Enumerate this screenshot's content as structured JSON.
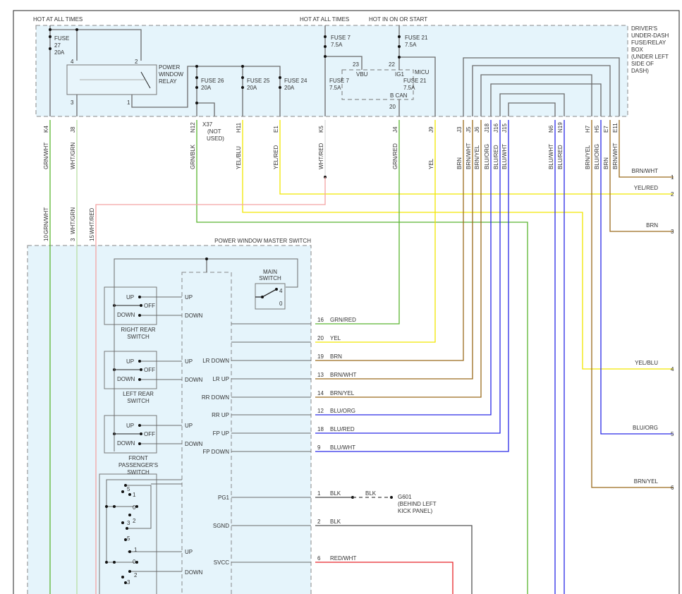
{
  "header": {
    "hot_all_times_1": "HOT AT ALL TIMES",
    "hot_all_times_2": "HOT AT ALL TIMES",
    "hot_on_start": "HOT IN ON OR START"
  },
  "fuse_box": {
    "label_lines": [
      "DRIVER'S",
      "UNDER-DASH",
      "FUSE/RELAY",
      "BOX",
      "(UNDER LEFT",
      "SIDE OF",
      "DASH)"
    ]
  },
  "fuses": [
    {
      "name": "FUSE",
      "num": "27",
      "amp": "20A"
    },
    {
      "name": "FUSE 26",
      "amp": "20A"
    },
    {
      "name": "FUSE 25",
      "amp": "20A"
    },
    {
      "name": "FUSE 24",
      "amp": "20A"
    },
    {
      "name": "FUSE 7",
      "amp": "7.5A"
    },
    {
      "name": "FUSE 21",
      "amp": "7.5A"
    }
  ],
  "relay": {
    "lines": [
      "POWER",
      "WINDOW",
      "RELAY"
    ],
    "pins": [
      "4",
      "2",
      "3",
      "1"
    ]
  },
  "micu": {
    "label": "MICU",
    "vbu": "VBU",
    "ig1": "IG1",
    "bcan": "B CAN",
    "pin23": "23",
    "pin22": "22",
    "pin20": "20"
  },
  "x37": {
    "pin": "X37",
    "note1": "(NOT",
    "note2": "USED)"
  },
  "colors": {
    "GRN": "#5bb531",
    "LTGRN": "#b9dea4",
    "YEL": "#f2e600",
    "RED": "#e8262a",
    "PINK": "#f3a3a3",
    "BRN": "#9a6b1c",
    "BLU": "#2a2ae6",
    "GRY": "#6b6b6b",
    "fill": "#e5f4fb"
  },
  "connectors": [
    {
      "pin": "K4",
      "wire": "GRN/WHT"
    },
    {
      "pin": "J8",
      "wire": "WHT/GRN"
    },
    {
      "pin": "N12",
      "wire": "GRN/BLK"
    },
    {
      "pin": "H11",
      "wire": "YEL/BLU"
    },
    {
      "pin": "E1",
      "wire": "YEL/RED"
    },
    {
      "pin": "K5",
      "wire": "WHT/RED"
    },
    {
      "pin": "J4",
      "wire": "GRN/RED"
    },
    {
      "pin": "J9",
      "wire": "YEL"
    },
    {
      "pin": "J3",
      "wire": "BRN"
    },
    {
      "pin": "J5",
      "wire": "BRN/WHT"
    },
    {
      "pin": "J6",
      "wire": "BRN/YEL"
    },
    {
      "pin": "J18",
      "wire": "BLU/ORG"
    },
    {
      "pin": "J16",
      "wire": "BLU/RED"
    },
    {
      "pin": "J15",
      "wire": "BLU/WHT"
    },
    {
      "pin": "N6",
      "wire": "BLU/WHT"
    },
    {
      "pin": "N19",
      "wire": "BLU/RED"
    },
    {
      "pin": "H7",
      "wire": "BRN/YEL"
    },
    {
      "pin": "H5",
      "wire": "BLU/ORG"
    },
    {
      "pin": "E7",
      "wire": "BRN"
    },
    {
      "pin": "E11",
      "wire": "BRN/WHT"
    }
  ],
  "outputs": [
    {
      "num": "1",
      "wire": "BRN/WHT"
    },
    {
      "num": "2",
      "wire": "YEL/RED"
    },
    {
      "num": "3",
      "wire": "BRN"
    },
    {
      "num": "4",
      "wire": "YEL/BLU"
    },
    {
      "num": "5",
      "wire": "BLU/ORG"
    },
    {
      "num": "6",
      "wire": "BRN/YEL"
    }
  ],
  "master_switch": {
    "title": "POWER WINDOW MASTER SWITCH",
    "top_pins": [
      {
        "pin": "10",
        "wire": "GRN/WHT"
      },
      {
        "pin": "3",
        "wire": "WHT/GRN"
      },
      {
        "pin": "15",
        "wire": "WHT/RED"
      }
    ],
    "main_switch": {
      "lines": [
        "MAIN",
        "SWITCH"
      ],
      "pos": [
        "4",
        "0"
      ]
    },
    "sub_switches": [
      {
        "lines": [
          "RIGHT REAR",
          "SWITCH"
        ],
        "up": "UP",
        "off": "OFF",
        "down": "DOWN"
      },
      {
        "lines": [
          "LEFT REAR",
          "SWITCH"
        ],
        "up": "UP",
        "off": "OFF",
        "down": "DOWN"
      },
      {
        "lines": [
          "FRONT",
          "PASSENGER'S",
          "SWITCH"
        ],
        "up": "UP",
        "off": "OFF",
        "down": "DOWN"
      }
    ],
    "logic_inputs": [
      "UP",
      "DOWN",
      "UP",
      "DOWN",
      "UP",
      "DOWN",
      "UP",
      "DOWN"
    ],
    "driver_positions": [
      "5",
      "1",
      "0",
      "2",
      "3",
      "5",
      "1",
      "0",
      "2",
      "3"
    ],
    "outputs": [
      {
        "signal": "",
        "pin": "16",
        "wire": "GRN/RED"
      },
      {
        "signal": "",
        "pin": "20",
        "wire": "YEL"
      },
      {
        "signal": "LR DOWN",
        "pin": "19",
        "wire": "BRN"
      },
      {
        "signal": "LR UP",
        "pin": "13",
        "wire": "BRN/WHT"
      },
      {
        "signal": "RR DOWN",
        "pin": "14",
        "wire": "BRN/YEL"
      },
      {
        "signal": "RR UP",
        "pin": "12",
        "wire": "BLU/ORG"
      },
      {
        "signal": "FP UP",
        "pin": "18",
        "wire": "BLU/RED"
      },
      {
        "signal": "FP DOWN",
        "pin": "9",
        "wire": "BLU/WHT"
      },
      {
        "signal": "PG1",
        "pin": "1",
        "wire": "BLK"
      },
      {
        "signal": "SGND",
        "pin": "2",
        "wire": "BLK"
      },
      {
        "signal": "SVCC",
        "pin": "6",
        "wire": "RED/WHT"
      }
    ]
  },
  "ground": {
    "wire": "BLK",
    "name": "G601",
    "loc1": "(BEHIND LEFT",
    "loc2": "KICK PANEL)"
  }
}
